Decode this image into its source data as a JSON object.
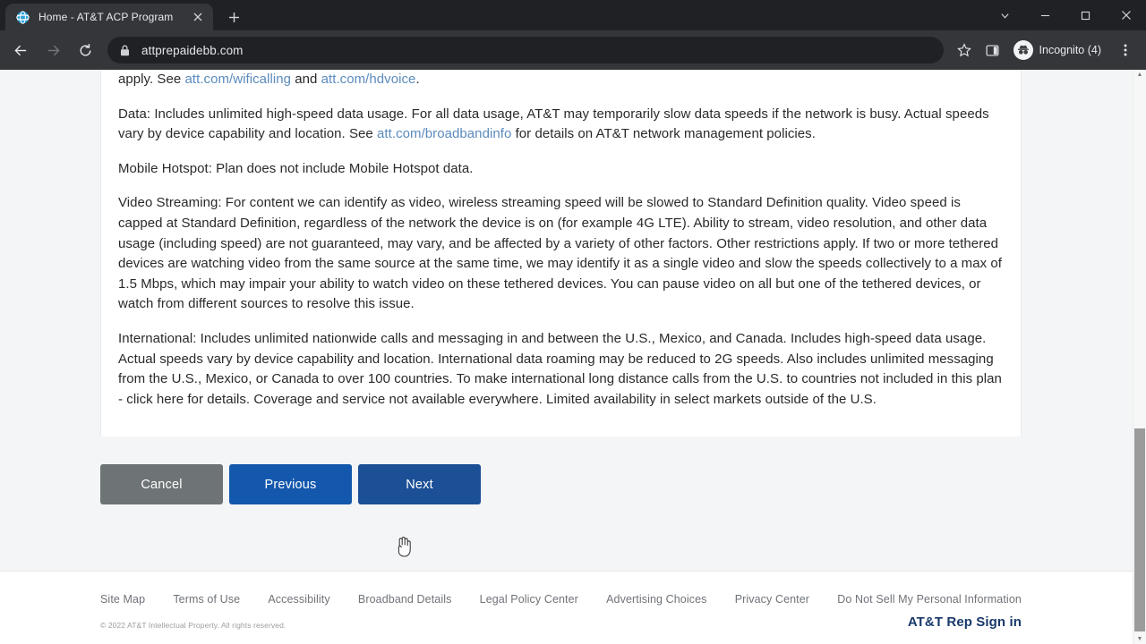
{
  "browser": {
    "tab": {
      "title": "Home - AT&T ACP Program",
      "favicon": "att-globe-icon",
      "close_icon": "close-icon"
    },
    "new_tab_label": "+",
    "window_controls": {
      "tab_search": "chevron-down-icon",
      "minimize": "minimize-icon",
      "maximize": "maximize-icon",
      "close": "close-icon"
    },
    "toolbar": {
      "back": "back-arrow-icon",
      "forward": "forward-arrow-icon",
      "reload": "reload-icon",
      "lock": "lock-icon",
      "url": "attprepaidebb.com",
      "bookmark": "star-icon",
      "side_panel": "side-panel-icon",
      "incognito_label": "Incognito (4)",
      "incognito_avatar": "incognito-icon",
      "menu": "kebab-menu-icon"
    }
  },
  "content": {
    "paragraphs": [
      {
        "id": "wificalling",
        "segments": [
          {
            "type": "text",
            "value": "apply. See "
          },
          {
            "type": "link",
            "value": "att.com/wificalling"
          },
          {
            "type": "text",
            "value": " and "
          },
          {
            "type": "link",
            "value": "att.com/hdvoice"
          },
          {
            "type": "text",
            "value": "."
          }
        ]
      },
      {
        "id": "data",
        "segments": [
          {
            "type": "text",
            "value": "Data: Includes unlimited high-speed data usage. For all data usage, AT&T may temporarily slow data speeds if the network is busy. Actual speeds vary by device capability and location. See "
          },
          {
            "type": "link",
            "value": "att.com/broadbandinfo"
          },
          {
            "type": "text",
            "value": " for details on AT&T network management policies."
          }
        ]
      },
      {
        "id": "mobile-hotspot",
        "segments": [
          {
            "type": "text",
            "value": "Mobile Hotspot: Plan does not include Mobile Hotspot data."
          }
        ]
      },
      {
        "id": "video-streaming",
        "segments": [
          {
            "type": "text",
            "value": "Video Streaming: For content we can identify as video, wireless streaming speed will be slowed to Standard Definition quality. Video speed is capped at Standard Definition, regardless of the network the device is on (for example 4G LTE). Ability to stream, video resolution, and other data usage (including speed) are not guaranteed, may vary, and be affected by a variety of other factors. Other restrictions apply. If two or more tethered devices are watching video from the same source at the same time, we may identify it as a single video and slow the speeds collectively to a max of 1.5 Mbps, which may impair your ability to watch video on these tethered devices. You can pause video on all but one of the tethered devices, or watch from different sources to resolve this issue."
          }
        ]
      },
      {
        "id": "international",
        "segments": [
          {
            "type": "text",
            "value": "International: Includes unlimited nationwide calls and messaging in and between the U.S., Mexico, and Canada. Includes high-speed data usage. Actual speeds vary by device capability and location. International data roaming may be reduced to 2G speeds. Also includes unlimited messaging from the U.S., Mexico, or Canada to over 100 countries. To make international long distance calls from the U.S. to countries not included in this plan - click here for details. Coverage and service not available everywhere. Limited availability in select markets outside of the U.S."
          }
        ]
      }
    ]
  },
  "actions": {
    "cancel": "Cancel",
    "previous": "Previous",
    "next": "Next"
  },
  "footer": {
    "links": [
      "Site Map",
      "Terms of Use",
      "Accessibility",
      "Broadband Details",
      "Legal Policy Center",
      "Advertising Choices",
      "Privacy Center",
      "Do Not Sell My Personal Information"
    ],
    "copyright": "© 2022 AT&T Intellectual Property. All rights reserved.",
    "rep_sign_in": "AT&T Rep Sign in"
  },
  "colors": {
    "cancel_button": "#6e7376",
    "previous_button": "#1358ac",
    "next_button": "#1b4f96",
    "link": "#5b8bbd",
    "rep_sign_in": "#18396b",
    "page_background": "#f4f5f7"
  }
}
